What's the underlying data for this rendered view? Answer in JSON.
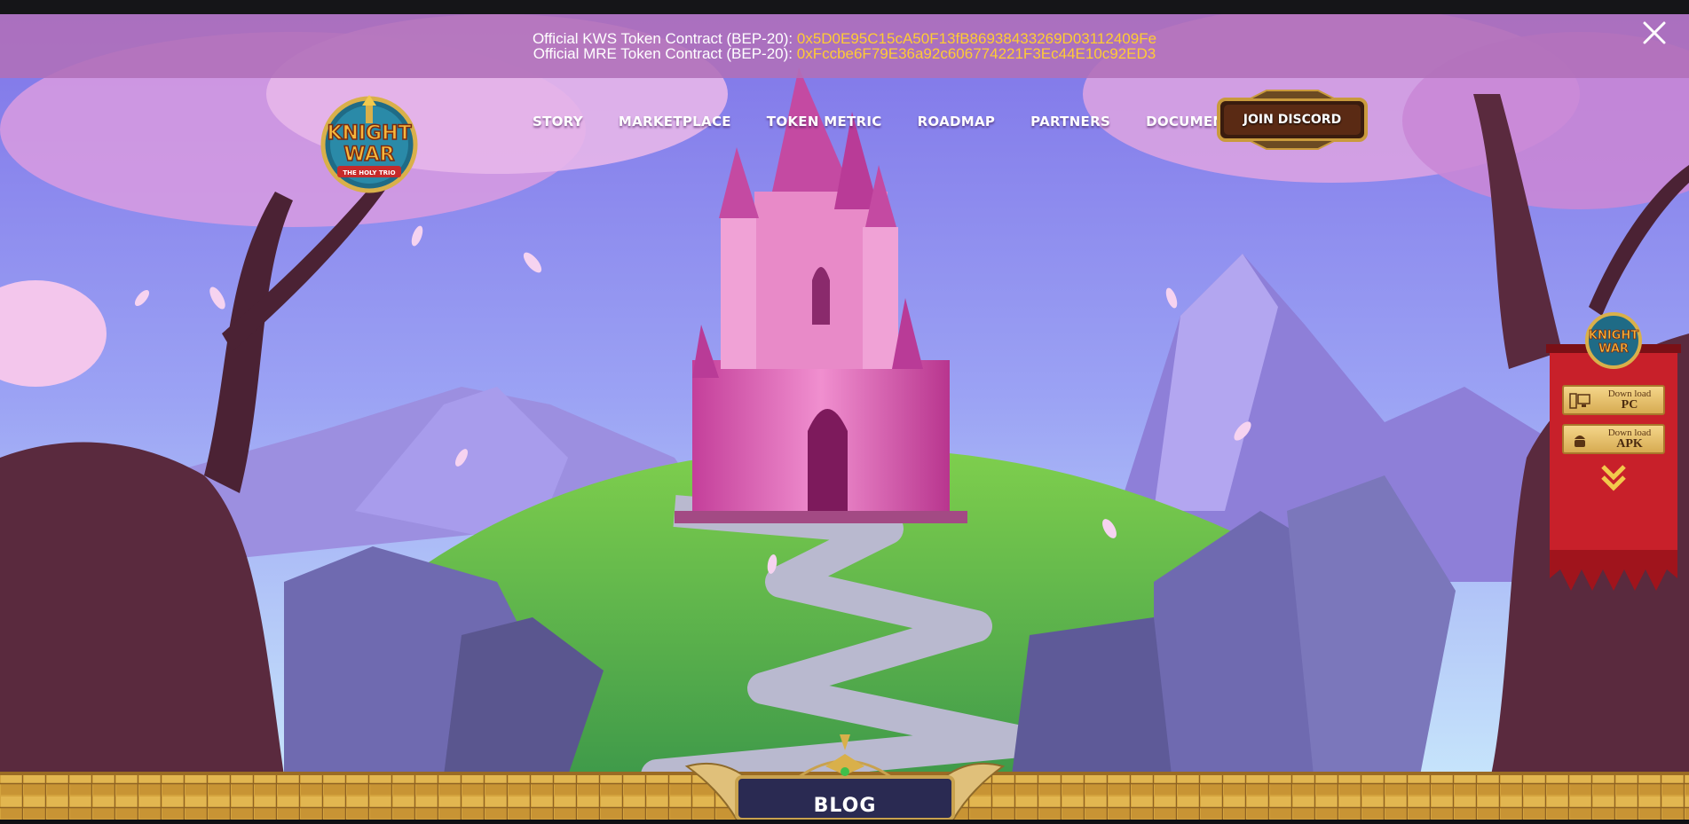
{
  "announcement": {
    "line1_prefix": "Official KWS Token Contract (BEP-20):",
    "line1_address": "0x5D0E95C15cA50F13fB86938433269D03112409Fe",
    "line2_prefix": "Official MRE Token Contract (BEP-20):",
    "line2_address": "0xFccbe6F79E36a92c606774221F3Ec44E10c92ED3",
    "close_icon": "close-icon"
  },
  "logo": {
    "line1": "KNIGHT",
    "line2": "WAR",
    "tagline": "THE HOLY TRIO"
  },
  "nav": {
    "items": [
      {
        "label": "STORY"
      },
      {
        "label": "MARKETPLACE"
      },
      {
        "label": "TOKEN METRIC"
      },
      {
        "label": "ROADMAP"
      },
      {
        "label": "PARTNERS"
      },
      {
        "label": "DOCUMENTS"
      }
    ],
    "cta_label": "JOIN DISCORD"
  },
  "side_download": {
    "logo_line1": "KNIGHT",
    "logo_line2": "WAR",
    "pc": {
      "small": "Down load",
      "big": "PC",
      "icon": "desktop-icon"
    },
    "apk": {
      "small": "Down load",
      "big": "APK",
      "icon": "android-icon"
    },
    "scroll_icon": "chevron-double-down-icon"
  },
  "footer": {
    "blog_label": "BLOG"
  },
  "colors": {
    "banner": "#b070b8",
    "address": "#ffcc33",
    "sky": "#8f8ff0",
    "castle": "#e06cc0",
    "side_banner": "#c8202a",
    "gold": "#d7ab52"
  }
}
